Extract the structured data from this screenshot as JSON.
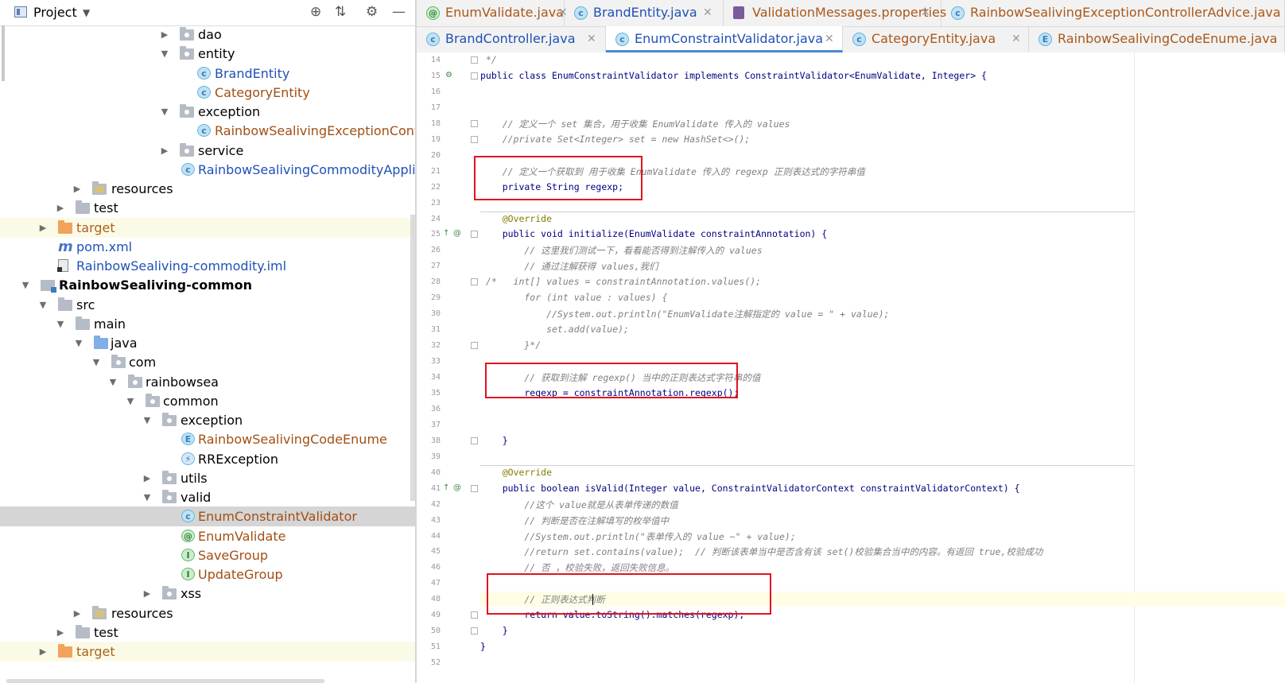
{
  "project_panel": {
    "title": "Project",
    "toolbar_icons": [
      "target-icon",
      "collapse-icon",
      "gear-icon",
      "minimize-icon"
    ],
    "tree": [
      {
        "label": "dao",
        "kind": "package",
        "expanded": false
      },
      {
        "label": "entity",
        "kind": "package",
        "expanded": true
      },
      {
        "label": "BrandEntity",
        "kind": "class"
      },
      {
        "label": "CategoryEntity",
        "kind": "class"
      },
      {
        "label": "exception",
        "kind": "package",
        "expanded": true
      },
      {
        "label": "RainbowSealivingExceptionContr",
        "kind": "class"
      },
      {
        "label": "service",
        "kind": "package",
        "expanded": false
      },
      {
        "label": "RainbowSealivingCommodityApplica",
        "kind": "spring-class"
      },
      {
        "label": "resources",
        "kind": "resources",
        "expanded": false
      },
      {
        "label": "test",
        "kind": "folder",
        "expanded": false
      },
      {
        "label": "target",
        "kind": "excluded-folder",
        "expanded": false
      },
      {
        "label": "pom.xml",
        "kind": "maven"
      },
      {
        "label": "RainbowSealiving-commodity.iml",
        "kind": "iml"
      },
      {
        "label": "RainbowSealiving-common",
        "kind": "module",
        "expanded": true
      },
      {
        "label": "src",
        "kind": "folder",
        "expanded": true
      },
      {
        "label": "main",
        "kind": "folder",
        "expanded": true
      },
      {
        "label": "java",
        "kind": "source-folder",
        "expanded": true
      },
      {
        "label": "com",
        "kind": "package",
        "expanded": true
      },
      {
        "label": "rainbowsea",
        "kind": "package",
        "expanded": true
      },
      {
        "label": "common",
        "kind": "package",
        "expanded": true
      },
      {
        "label": "exception",
        "kind": "package",
        "expanded": true
      },
      {
        "label": "RainbowSealivingCodeEnume",
        "kind": "enum"
      },
      {
        "label": "RRException",
        "kind": "exception-class"
      },
      {
        "label": "utils",
        "kind": "package",
        "expanded": false
      },
      {
        "label": "valid",
        "kind": "package",
        "expanded": true
      },
      {
        "label": "EnumConstraintValidator",
        "kind": "class",
        "selected": true
      },
      {
        "label": "EnumValidate",
        "kind": "annotation"
      },
      {
        "label": "SaveGroup",
        "kind": "interface"
      },
      {
        "label": "UpdateGroup",
        "kind": "interface"
      },
      {
        "label": "xss",
        "kind": "package",
        "expanded": false
      },
      {
        "label": "resources",
        "kind": "resources",
        "expanded": false
      },
      {
        "label": "test",
        "kind": "folder",
        "expanded": false
      },
      {
        "label": "target",
        "kind": "excluded-folder",
        "expanded": false
      }
    ]
  },
  "editor": {
    "tabs_row1": [
      {
        "label": "EnumValidate.java",
        "icon": "annotation-icon"
      },
      {
        "label": "BrandEntity.java",
        "icon": "class-icon"
      },
      {
        "label": "ValidationMessages.properties",
        "icon": "properties-icon"
      },
      {
        "label": "RainbowSealivingExceptionControllerAdvice.java",
        "icon": "class-icon"
      }
    ],
    "tabs_row2": [
      {
        "label": "BrandController.java",
        "icon": "class-icon"
      },
      {
        "label": "EnumConstraintValidator.java",
        "icon": "class-icon",
        "active": true
      },
      {
        "label": "CategoryEntity.java",
        "icon": "class-icon"
      },
      {
        "label": "RainbowSealivingCodeEnume.java",
        "icon": "enum-icon"
      }
    ],
    "close_glyph": "✕",
    "lines": [
      {
        "n": "14",
        "text": " */"
      },
      {
        "n": "15",
        "text": "public class EnumConstraintValidator implements ConstraintValidator<EnumValidate, Integer> {"
      },
      {
        "n": "16",
        "text": ""
      },
      {
        "n": "17",
        "text": ""
      },
      {
        "n": "18",
        "text": "    // 定义一个 set 集合，用于收集 EnumValidate 传入的 values"
      },
      {
        "n": "19",
        "text": "    //private Set<Integer> set = new HashSet<>();"
      },
      {
        "n": "20",
        "text": ""
      },
      {
        "n": "21",
        "text": "    // 定义一个获取到 用于收集 EnumValidate 传入的 regexp 正则表达式的字符串值"
      },
      {
        "n": "22",
        "text": "    private String regexp;"
      },
      {
        "n": "23",
        "text": ""
      },
      {
        "n": "24",
        "text": "    @Override"
      },
      {
        "n": "25",
        "text": "    public void initialize(EnumValidate constraintAnnotation) {"
      },
      {
        "n": "26",
        "text": "        // 这里我们测试一下，看看能否得到注解传入的 values"
      },
      {
        "n": "27",
        "text": "        // 通过注解获得 values,我们"
      },
      {
        "n": "28",
        "text": " /*   int[] values = constraintAnnotation.values();"
      },
      {
        "n": "29",
        "text": "        for (int value : values) {"
      },
      {
        "n": "30",
        "text": "            //System.out.println(\"EnumValidate注解指定的 value = \" + value);"
      },
      {
        "n": "31",
        "text": "            set.add(value);"
      },
      {
        "n": "32",
        "text": "        }*/"
      },
      {
        "n": "33",
        "text": ""
      },
      {
        "n": "34",
        "text": "        // 获取到注解 regexp() 当中的正则表达式字符串的值"
      },
      {
        "n": "35",
        "text": "        regexp = constraintAnnotation.regexp();"
      },
      {
        "n": "36",
        "text": ""
      },
      {
        "n": "37",
        "text": ""
      },
      {
        "n": "38",
        "text": "    }"
      },
      {
        "n": "39",
        "text": ""
      },
      {
        "n": "40",
        "text": "    @Override"
      },
      {
        "n": "41",
        "text": "    public boolean isValid(Integer value, ConstraintValidatorContext constraintValidatorContext) {"
      },
      {
        "n": "42",
        "text": "        //这个 value就是从表单传递的数值"
      },
      {
        "n": "43",
        "text": "        // 判断是否在注解填写的枚举值中"
      },
      {
        "n": "44",
        "text": "        //System.out.println(\"表单传入的 value ~\" + value);"
      },
      {
        "n": "45",
        "text": "        //return set.contains(value);  // 判断该表单当中是否含有该 set()校验集合当中的内容。有返回 true,校验成功"
      },
      {
        "n": "46",
        "text": "        // 否 ，校验失败，返回失败信息。"
      },
      {
        "n": "47",
        "text": ""
      },
      {
        "n": "48",
        "text": "        // 正则表达式判断"
      },
      {
        "n": "49",
        "text": "        return value.toString().matches(regexp);"
      },
      {
        "n": "50",
        "text": "    }"
      },
      {
        "n": "51",
        "text": "}"
      },
      {
        "n": "52",
        "text": ""
      }
    ]
  }
}
